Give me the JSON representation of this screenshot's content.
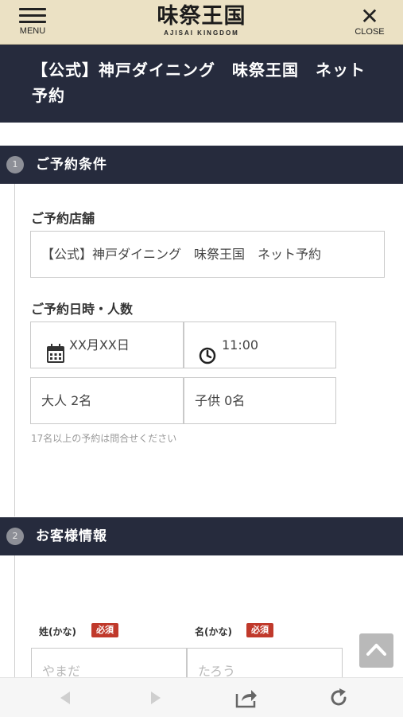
{
  "header": {
    "menu_label": "MENU",
    "logo_main": "味祭王国",
    "logo_sub": "AJISAI KINGDOM",
    "close_label": "CLOSE"
  },
  "page": {
    "title": "【公式】神戸ダイニング　味祭王国　ネット予約"
  },
  "section1": {
    "step": "1",
    "title": "ご予約条件",
    "store_label": "ご予約店舗",
    "store_value": "【公式】神戸ダイニング　味祭王国　ネット予約",
    "datetime_label": "ご予約日時・人数",
    "date_value": "XX月XX日",
    "time_value": "11:00",
    "adults_value": "大人 2名",
    "children_value": "子供 0名",
    "note": "17名以上の予約は問合せください"
  },
  "section2": {
    "step": "2",
    "title": "お客様情報",
    "last_kana_label": "姓(かな)",
    "first_kana_label": "名(かな)",
    "required_badge": "必須",
    "last_kana_placeholder": "やまだ",
    "first_kana_placeholder": "たろう"
  },
  "colors": {
    "header_bg": "#ebe1c4",
    "dark_navy": "#262b3d",
    "required_red": "#c0392b"
  }
}
